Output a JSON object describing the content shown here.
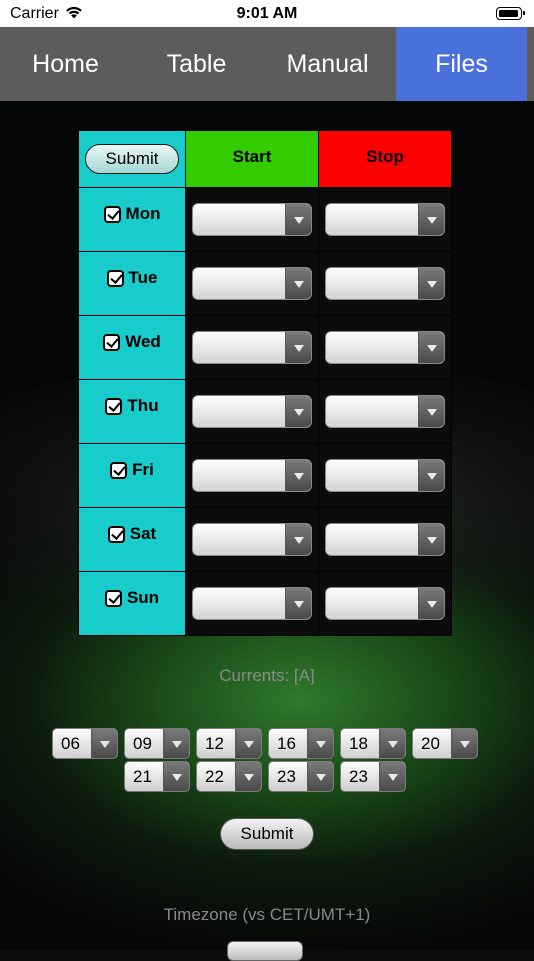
{
  "status_bar": {
    "carrier": "Carrier",
    "time": "9:01 AM"
  },
  "nav": {
    "tabs": [
      {
        "label": "Home",
        "active": false
      },
      {
        "label": "Table",
        "active": false
      },
      {
        "label": "Manual",
        "active": false
      },
      {
        "label": "Files",
        "active": true
      }
    ]
  },
  "schedule": {
    "submit_label": "Submit",
    "start_label": "Start",
    "stop_label": "Stop",
    "days": [
      {
        "label": "Mon",
        "checked": true,
        "start": "",
        "stop": ""
      },
      {
        "label": "Tue",
        "checked": true,
        "start": "",
        "stop": ""
      },
      {
        "label": "Wed",
        "checked": true,
        "start": "",
        "stop": ""
      },
      {
        "label": "Thu",
        "checked": true,
        "start": "",
        "stop": ""
      },
      {
        "label": "Fri",
        "checked": true,
        "start": "",
        "stop": ""
      },
      {
        "label": "Sat",
        "checked": true,
        "start": "",
        "stop": ""
      },
      {
        "label": "Sun",
        "checked": true,
        "start": "",
        "stop": ""
      }
    ]
  },
  "currents": {
    "label": "Currents: [A]",
    "values": [
      "06",
      "09",
      "12",
      "16",
      "18",
      "20",
      "21",
      "22",
      "23",
      "23"
    ],
    "submit_label": "Submit"
  },
  "timezone": {
    "label": "Timezone (vs CET/UMT+1)"
  },
  "colors": {
    "accent_tab": "#4a70dc",
    "day_cell": "#18cccc",
    "start": "#33cc00",
    "stop": "#ff0000"
  }
}
